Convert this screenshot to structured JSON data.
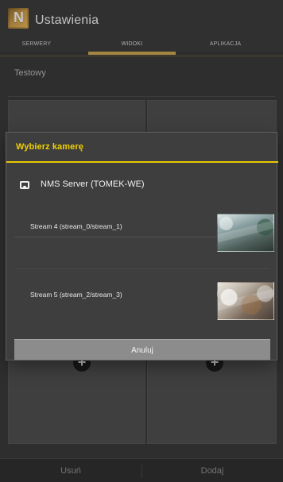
{
  "app": {
    "title": "Ustawienia"
  },
  "tabs": [
    {
      "label": "SERWERY"
    },
    {
      "label": "WIDOKI"
    },
    {
      "label": "APLIKACJA"
    }
  ],
  "background": {
    "section_label": "Testowy",
    "bottom_buttons": {
      "left": "Usuń",
      "right": "Dodaj"
    }
  },
  "dialog": {
    "title": "Wybierz kamerę",
    "server": {
      "name": "NMS Server (TOMEK-WE)",
      "icon": "server-icon"
    },
    "streams": [
      {
        "label": "Stream 4 (stream_0/stream_1)"
      },
      {
        "label": "Stream 5 (stream_2/stream_3)"
      }
    ],
    "footer": {
      "label": "Anuluj"
    }
  },
  "colors": {
    "accent": "#c7a451",
    "title_yellow": "#f0d000"
  },
  "icons": {
    "logo": "app-logo",
    "plus": "plus-icon"
  }
}
